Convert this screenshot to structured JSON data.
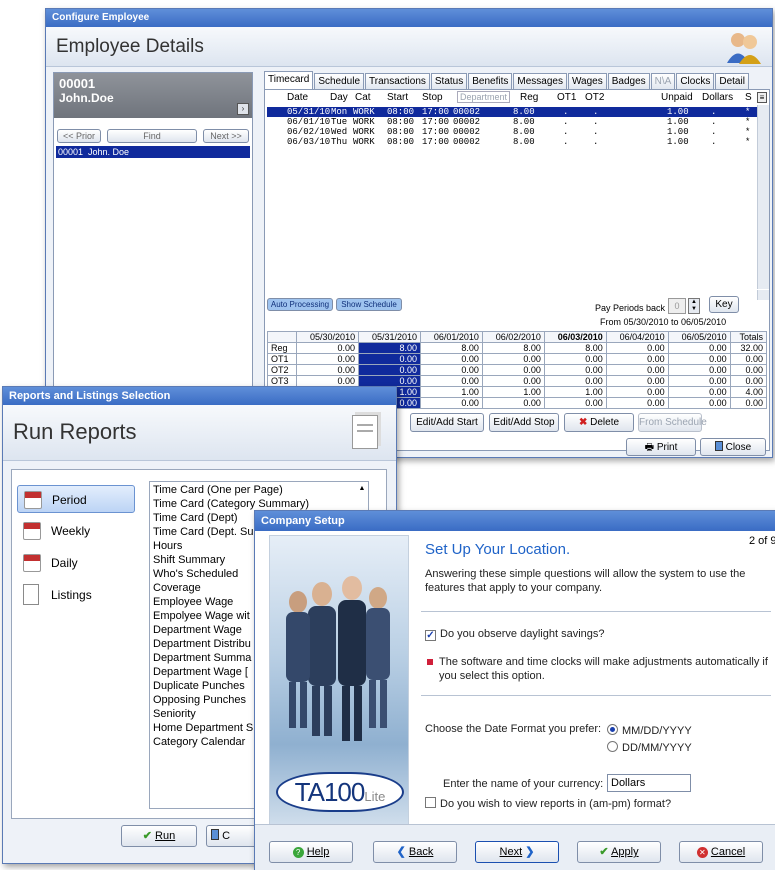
{
  "employee_window": {
    "title": "Configure Employee",
    "header": "Employee Details",
    "emp_id": "00001",
    "emp_name": "John.Doe",
    "prior": "<< Prior",
    "find": "Find",
    "next": "Next >>",
    "list_item": "00001  John. Doe",
    "tabs": [
      "Timecard",
      "Schedule",
      "Transactions",
      "Status",
      "Benefits",
      "Messages",
      "Wages",
      "Badges",
      "N\\A",
      "Clocks",
      "Detail"
    ],
    "columns": [
      "Date",
      "Day",
      "Cat",
      "Start",
      "Stop",
      "Department",
      "Reg",
      "OT1",
      "OT2",
      "Unpaid",
      "Dollars",
      "S"
    ],
    "rows": [
      {
        "date": "05/31/10",
        "day": "Mon",
        "cat": "WORK",
        "start": "08:00",
        "stop": "17:00",
        "dept": "00002",
        "reg": "8.00",
        "ot1": ".",
        "ot2": ".",
        "unpaid": "1.00",
        "dollars": "."
      },
      {
        "date": "06/01/10",
        "day": "Tue",
        "cat": "WORK",
        "start": "08:00",
        "stop": "17:00",
        "dept": "00002",
        "reg": "8.00",
        "ot1": ".",
        "ot2": ".",
        "unpaid": "1.00",
        "dollars": "."
      },
      {
        "date": "06/02/10",
        "day": "Wed",
        "cat": "WORK",
        "start": "08:00",
        "stop": "17:00",
        "dept": "00002",
        "reg": "8.00",
        "ot1": ".",
        "ot2": ".",
        "unpaid": "1.00",
        "dollars": "."
      },
      {
        "date": "06/03/10",
        "day": "Thu",
        "cat": "WORK",
        "start": "08:00",
        "stop": "17:00",
        "dept": "00002",
        "reg": "8.00",
        "ot1": ".",
        "ot2": ".",
        "unpaid": "1.00",
        "dollars": "."
      }
    ],
    "auto_processing": "Auto Processing",
    "show_schedule": "Show Schedule",
    "pay_periods_back_label": "Pay Periods back",
    "pay_periods_back": "0",
    "key": "Key",
    "range": "From 05/30/2010 to 06/05/2010",
    "summary_dates": [
      "05/30/2010",
      "05/31/2010",
      "06/01/2010",
      "06/02/2010",
      "06/03/2010",
      "06/04/2010",
      "06/05/2010",
      "Totals"
    ],
    "summary_rows": [
      {
        "label": "Reg",
        "vals": [
          "0.00",
          "8.00",
          "8.00",
          "8.00",
          "8.00",
          "0.00",
          "0.00",
          "32.00"
        ]
      },
      {
        "label": "OT1",
        "vals": [
          "0.00",
          "0.00",
          "0.00",
          "0.00",
          "0.00",
          "0.00",
          "0.00",
          "0.00"
        ]
      },
      {
        "label": "OT2",
        "vals": [
          "0.00",
          "0.00",
          "0.00",
          "0.00",
          "0.00",
          "0.00",
          "0.00",
          "0.00"
        ]
      },
      {
        "label": "OT3",
        "vals": [
          "0.00",
          "0.00",
          "0.00",
          "0.00",
          "0.00",
          "0.00",
          "0.00",
          "0.00"
        ]
      },
      {
        "label": "",
        "vals": [
          "",
          "1.00",
          "1.00",
          "1.00",
          "1.00",
          "0.00",
          "0.00",
          "4.00"
        ]
      },
      {
        "label": "",
        "vals": [
          "",
          "0.00",
          "0.00",
          "0.00",
          "0.00",
          "0.00",
          "0.00",
          "0.00"
        ]
      }
    ],
    "edit_add_start": "Edit/Add Start",
    "edit_add_stop": "Edit/Add Stop",
    "delete": "Delete",
    "from_schedule": "From Schedule",
    "print": "Print",
    "close": "Close"
  },
  "reports_window": {
    "title": "Reports and Listings Selection",
    "header": "Run Reports",
    "nav": [
      "Period",
      "Weekly",
      "Daily",
      "Listings"
    ],
    "reports": [
      "Time Card (One per Page)",
      "Time Card (Category Summary)",
      "Time Card (Dept)",
      "Time Card (Dept. Su",
      "Hours",
      "Shift Summary",
      "Who's Scheduled",
      "Coverage",
      "Employee Wage",
      "Empolyee Wage wit",
      "Department Wage",
      "Department Distribu",
      "Department Summa",
      "Department Wage [",
      "Duplicate Punches",
      "Opposing Punches",
      "Seniority",
      "Home Department S",
      "Category Calendar"
    ],
    "run": "Run",
    "close_partial": "C"
  },
  "setup_window": {
    "title": "Company Setup",
    "page": "2 of 9",
    "heading": "Set Up Your Location.",
    "intro": "Answering these simple questions will allow the system to use the features that apply to your company.",
    "dst_q": "Do you observe daylight savings?",
    "dst_note": "The software and time clocks will make adjustments automatically if you select this option.",
    "date_label": "Choose the Date Format you prefer:",
    "date_opts": [
      "MM/DD/YYYY",
      "DD/MM/YYYY"
    ],
    "currency_label": "Enter the name of your currency:",
    "currency": "Dollars",
    "ampm_q": "Do you wish to view reports in (am-pm) format?",
    "logo_ta": "TA100",
    "logo_lite": "Lite",
    "help": "Help",
    "back": "Back",
    "next": "Next",
    "apply": "Apply",
    "cancel": "Cancel"
  },
  "colors": {
    "title_blue": "#3a6cc4",
    "selection": "#102a9c",
    "accent_heading": "#1f63c8"
  }
}
